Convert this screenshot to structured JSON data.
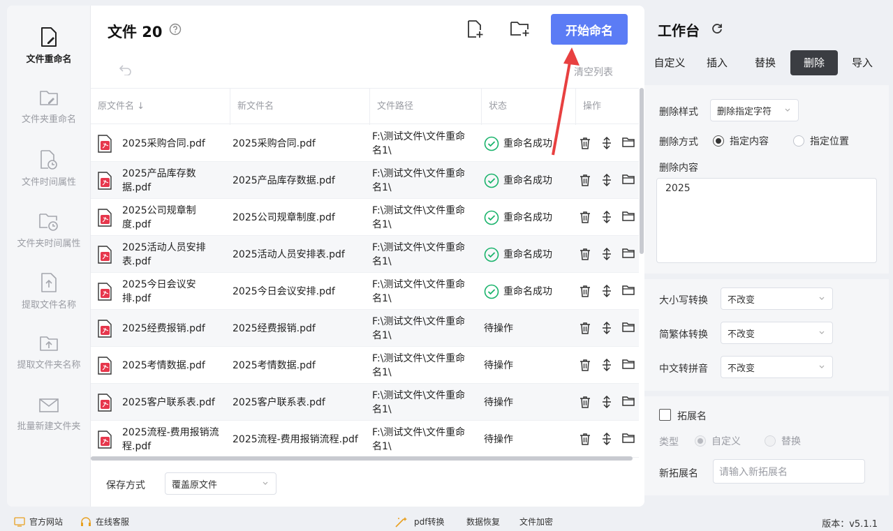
{
  "sidebar": {
    "items": [
      {
        "label": "文件重命名",
        "icon": "file-rename-icon"
      },
      {
        "label": "文件夹重命名",
        "icon": "folder-rename-icon"
      },
      {
        "label": "文件时间属性",
        "icon": "file-time-icon"
      },
      {
        "label": "文件夹时间属性",
        "icon": "folder-time-icon"
      },
      {
        "label": "提取文件名称",
        "icon": "extract-file-icon"
      },
      {
        "label": "提取文件夹名称",
        "icon": "extract-folder-icon"
      },
      {
        "label": "批量新建文件夹",
        "icon": "batch-folder-icon"
      }
    ]
  },
  "header": {
    "title": "文件 20",
    "start_label": "开始命名",
    "clear_label": "清空列表",
    "accent": "#5b7cf5"
  },
  "table": {
    "columns": [
      "原文件名",
      "新文件名",
      "文件路径",
      "状态",
      "操作"
    ],
    "rows": [
      {
        "orig": "2025采购合同.pdf",
        "new": "2025采购合同.pdf",
        "path": "F:\\测试文件\\文件重命名1\\",
        "status": "重命名成功",
        "ok": true
      },
      {
        "orig": "2025产品库存数据.pdf",
        "new": "2025产品库存数据.pdf",
        "path": "F:\\测试文件\\文件重命名1\\",
        "status": "重命名成功",
        "ok": true
      },
      {
        "orig": "2025公司规章制度.pdf",
        "new": "2025公司规章制度.pdf",
        "path": "F:\\测试文件\\文件重命名1\\",
        "status": "重命名成功",
        "ok": true
      },
      {
        "orig": "2025活动人员安排表.pdf",
        "new": "2025活动人员安排表.pdf",
        "path": "F:\\测试文件\\文件重命名1\\",
        "status": "重命名成功",
        "ok": true
      },
      {
        "orig": "2025今日会议安排.pdf",
        "new": "2025今日会议安排.pdf",
        "path": "F:\\测试文件\\文件重命名1\\",
        "status": "重命名成功",
        "ok": true
      },
      {
        "orig": "2025经费报销.pdf",
        "new": "2025经费报销.pdf",
        "path": "F:\\测试文件\\文件重命名1\\",
        "status": "待操作",
        "ok": false
      },
      {
        "orig": "2025考情数据.pdf",
        "new": "2025考情数据.pdf",
        "path": "F:\\测试文件\\文件重命名1\\",
        "status": "待操作",
        "ok": false
      },
      {
        "orig": "2025客户联系表.pdf",
        "new": "2025客户联系表.pdf",
        "path": "F:\\测试文件\\文件重命名1\\",
        "status": "待操作",
        "ok": false
      },
      {
        "orig": "2025流程-费用报销流程.pdf",
        "new": "2025流程-费用报销流程.pdf",
        "path": "F:\\测试文件\\文件重命名1\\",
        "status": "待操作",
        "ok": false
      }
    ]
  },
  "save": {
    "label": "保存方式",
    "value": "覆盖原文件"
  },
  "workspace": {
    "title": "工作台",
    "tabs": [
      "自定义",
      "插入",
      "替换",
      "删除",
      "导入"
    ],
    "active_tab": "删除",
    "delete_style_label": "删除样式",
    "delete_style_value": "删除指定字符",
    "delete_mode_label": "删除方式",
    "mode_content": "指定内容",
    "mode_position": "指定位置",
    "delete_content_label": "删除内容",
    "delete_content_value": "2025",
    "case_label": "大小写转换",
    "case_value": "不改变",
    "trad_label": "简繁体转换",
    "trad_value": "不改变",
    "pinyin_label": "中文转拼音",
    "pinyin_value": "不改变",
    "ext_label": "拓展名",
    "type_label": "类型",
    "type_custom": "自定义",
    "type_replace": "替换",
    "new_ext_label": "新拓展名",
    "new_ext_placeholder": "请输入新拓展名"
  },
  "footer": {
    "website": "官方网站",
    "service": "在线客服",
    "pdf": "pdf转换",
    "recover": "数据恢复",
    "encrypt": "文件加密",
    "version": "版本：v5.1.1"
  }
}
